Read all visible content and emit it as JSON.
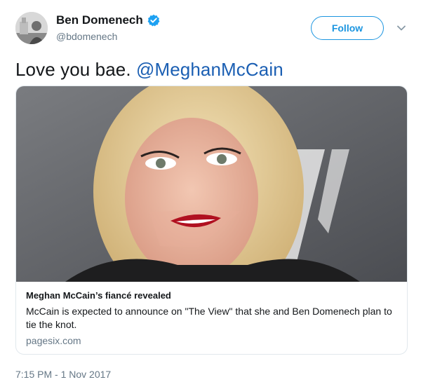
{
  "user": {
    "display_name": "Ben Domenech",
    "handle": "@bdomenech",
    "verified": true,
    "avatar_icon": "user-avatar"
  },
  "actions": {
    "follow_label": "Follow",
    "menu_icon": "chevron-down-icon"
  },
  "tweet": {
    "text": "Love you bae. ",
    "mention": "@MeghanMcCain"
  },
  "card": {
    "title": "Meghan McCain’s fiancé revealed",
    "description": "McCain is expected to announce on \"The View\" that she and Ben Domenech plan to tie the knot.",
    "domain": "pagesix.com",
    "image_icon": "photo-of-woman"
  },
  "timestamp": "7:15 PM - 1 Nov 2017",
  "colors": {
    "accent": "#1b95e0",
    "mention": "#1b5fb3",
    "muted": "#657786",
    "border": "#e1e8ed"
  }
}
